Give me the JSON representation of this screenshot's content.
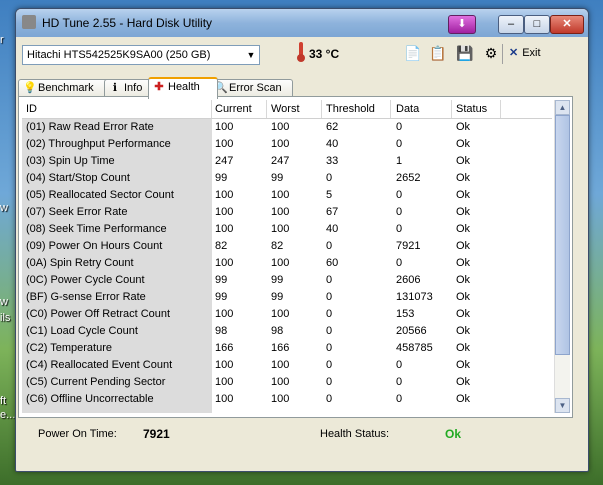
{
  "window": {
    "title": "HD Tune 2.55 - Hard Disk Utility",
    "buttons": {
      "download_icon": "download-icon",
      "minimize": "–",
      "maximize": "□",
      "close": "✕"
    }
  },
  "desktop_fragments": [
    "r",
    "w",
    "w",
    "ils",
    "ft",
    "e..."
  ],
  "toolbar": {
    "drive": "Hitachi HTS542525K9SA00 (250 GB)",
    "temperature": "33 °C",
    "exit_label": "Exit",
    "icons": [
      "copy-text-icon",
      "copy-screenshot-icon",
      "save-icon",
      "options-icon"
    ]
  },
  "tabs": [
    {
      "label": "Benchmark",
      "icon": "benchmark-icon",
      "active": false
    },
    {
      "label": "Info",
      "icon": "info-icon",
      "active": false
    },
    {
      "label": "Health",
      "icon": "health-cross-icon",
      "active": true
    },
    {
      "label": "Error Scan",
      "icon": "magnifier-icon",
      "active": false
    }
  ],
  "table": {
    "headers": [
      "ID",
      "Current",
      "Worst",
      "Threshold",
      "Data",
      "Status"
    ],
    "rows": [
      [
        "(01) Raw Read Error Rate",
        "100",
        "100",
        "62",
        "0",
        "Ok"
      ],
      [
        "(02) Throughput Performance",
        "100",
        "100",
        "40",
        "0",
        "Ok"
      ],
      [
        "(03) Spin Up Time",
        "247",
        "247",
        "33",
        "1",
        "Ok"
      ],
      [
        "(04) Start/Stop Count",
        "99",
        "99",
        "0",
        "2652",
        "Ok"
      ],
      [
        "(05) Reallocated Sector Count",
        "100",
        "100",
        "5",
        "0",
        "Ok"
      ],
      [
        "(07) Seek Error Rate",
        "100",
        "100",
        "67",
        "0",
        "Ok"
      ],
      [
        "(08) Seek Time Performance",
        "100",
        "100",
        "40",
        "0",
        "Ok"
      ],
      [
        "(09) Power On Hours Count",
        "82",
        "82",
        "0",
        "7921",
        "Ok"
      ],
      [
        "(0A) Spin Retry Count",
        "100",
        "100",
        "60",
        "0",
        "Ok"
      ],
      [
        "(0C) Power Cycle Count",
        "99",
        "99",
        "0",
        "2606",
        "Ok"
      ],
      [
        "(BF) G-sense Error Rate",
        "99",
        "99",
        "0",
        "131073",
        "Ok"
      ],
      [
        "(C0) Power Off Retract Count",
        "100",
        "100",
        "0",
        "153",
        "Ok"
      ],
      [
        "(C1) Load Cycle Count",
        "98",
        "98",
        "0",
        "20566",
        "Ok"
      ],
      [
        "(C2) Temperature",
        "166",
        "166",
        "0",
        "458785",
        "Ok"
      ],
      [
        "(C4) Reallocated Event Count",
        "100",
        "100",
        "0",
        "0",
        "Ok"
      ],
      [
        "(C5) Current Pending Sector",
        "100",
        "100",
        "0",
        "0",
        "Ok"
      ],
      [
        "(C6) Offline Uncorrectable",
        "100",
        "100",
        "0",
        "0",
        "Ok"
      ]
    ]
  },
  "status": {
    "power_on_label": "Power On Time:",
    "power_on_value": "7921",
    "health_label": "Health Status:",
    "health_value": "Ok",
    "health_color": "#22aa22"
  }
}
